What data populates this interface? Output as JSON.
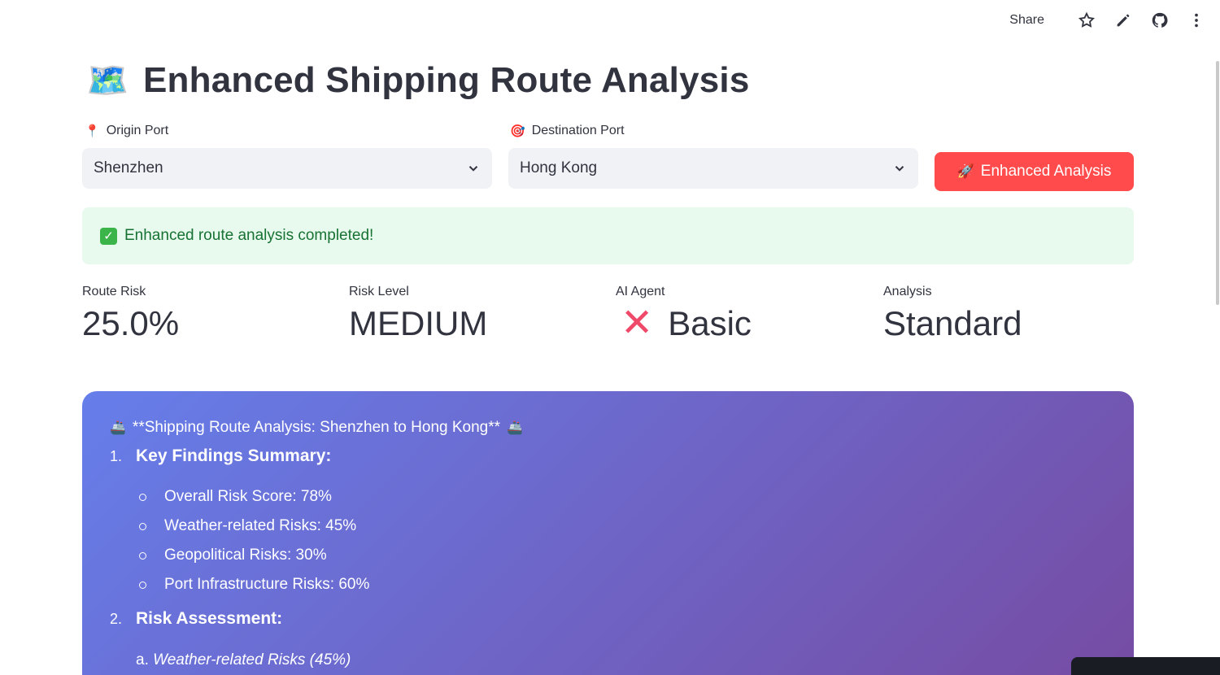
{
  "toolbar": {
    "share_label": "Share"
  },
  "header": {
    "icon": "world-map-icon",
    "title": "Enhanced Shipping Route Analysis"
  },
  "origin": {
    "label": "Origin Port",
    "icon": "pushpin-icon",
    "value": "Shenzhen"
  },
  "destination": {
    "label": "Destination Port",
    "icon": "target-icon",
    "value": "Hong Kong"
  },
  "analyze_button": {
    "label": "Enhanced Analysis",
    "icon": "rocket-icon"
  },
  "success": {
    "message": "Enhanced route analysis completed!"
  },
  "metrics": [
    {
      "label": "Route Risk",
      "value": "25.0%"
    },
    {
      "label": "Risk Level",
      "value": "MEDIUM"
    },
    {
      "label": "AI Agent",
      "value": "Basic",
      "icon": "cross-mark-icon"
    },
    {
      "label": "Analysis",
      "value": "Standard"
    }
  ],
  "report": {
    "heading": "**Shipping Route Analysis: Shenzhen to Hong Kong**",
    "sections": [
      {
        "number": "1.",
        "title": "Key Findings Summary:",
        "bullets": [
          "Overall Risk Score: 78%",
          "Weather-related Risks: 45%",
          "Geopolitical Risks: 30%",
          "Port Infrastructure Risks: 60%"
        ]
      },
      {
        "number": "2.",
        "title": "Risk Assessment:",
        "sub_prefix": "a.",
        "sub_text": "Weather-related Risks (45%)"
      }
    ]
  },
  "colors": {
    "accent": "#ff4b4b",
    "success_bg": "#e8f9ee",
    "success_text": "#177233",
    "gradient_start": "#667eea",
    "gradient_end": "#764ba2"
  }
}
